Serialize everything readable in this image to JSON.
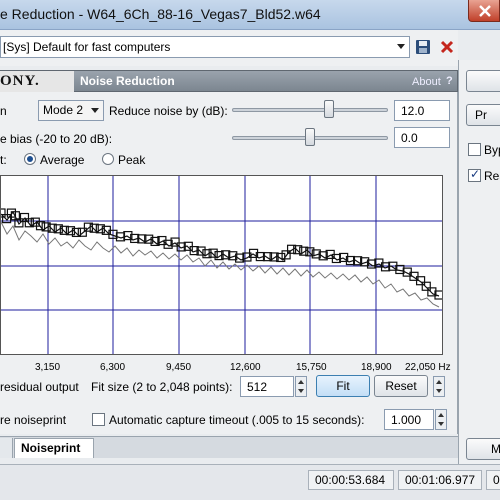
{
  "window": {
    "title": "e Reduction - W64_6Ch_88-16_Vegas7_Bld52.w64"
  },
  "preset": {
    "value": "[Sys] Default for fast computers"
  },
  "plugin": {
    "logo": "ONY.",
    "name": "Noise Reduction",
    "about": "About",
    "help": "?"
  },
  "controls": {
    "mode_label": "n",
    "mode_value": "Mode 2",
    "reduce_label": "Reduce noise by (dB):",
    "reduce_value": "12.0",
    "reduce_level": 0.62,
    "bias_label": "e bias (-20 to 20 dB):",
    "bias_value": "0.0",
    "bias_level": 0.5,
    "display_label": "t:",
    "display_options": [
      "Average",
      "Peak"
    ],
    "display_selected": "Average"
  },
  "graph": {
    "x_ticks": [
      "3,150",
      "6,300",
      "9,450",
      "12,600",
      "15,750",
      "18,900",
      "22,050 Hz"
    ],
    "residual_label": "residual output",
    "fit_size_label": "Fit size (2 to 2,048 points):",
    "fit_size_value": "512",
    "fit_button": "Fit",
    "reset_button": "Reset"
  },
  "capture": {
    "noiseprint_label": "re noiseprint",
    "auto_timeout_label": "Automatic capture timeout (.005 to 15 seconds):",
    "auto_timeout_checked": false,
    "timeout_value": "1.000"
  },
  "tabs": {
    "left_partial": "",
    "noiseprint": "Noiseprint"
  },
  "side": {
    "btn1": "Pr",
    "byp_label": "Byp",
    "rea_label": "Rea",
    "rea_checked": true,
    "bottom_btn": "M"
  },
  "status": {
    "time1": "00:00:53.684",
    "time2": "00:01:06.977",
    "time3": "00:0"
  },
  "icons": {
    "save": "save-icon",
    "delete": "delete-icon",
    "close": "close-icon",
    "help": "help-icon"
  },
  "colors": {
    "grid": "#1d1d9c",
    "trace_dark": "#111111",
    "trace_light": "#777777",
    "fit_button": "#c3def6"
  }
}
